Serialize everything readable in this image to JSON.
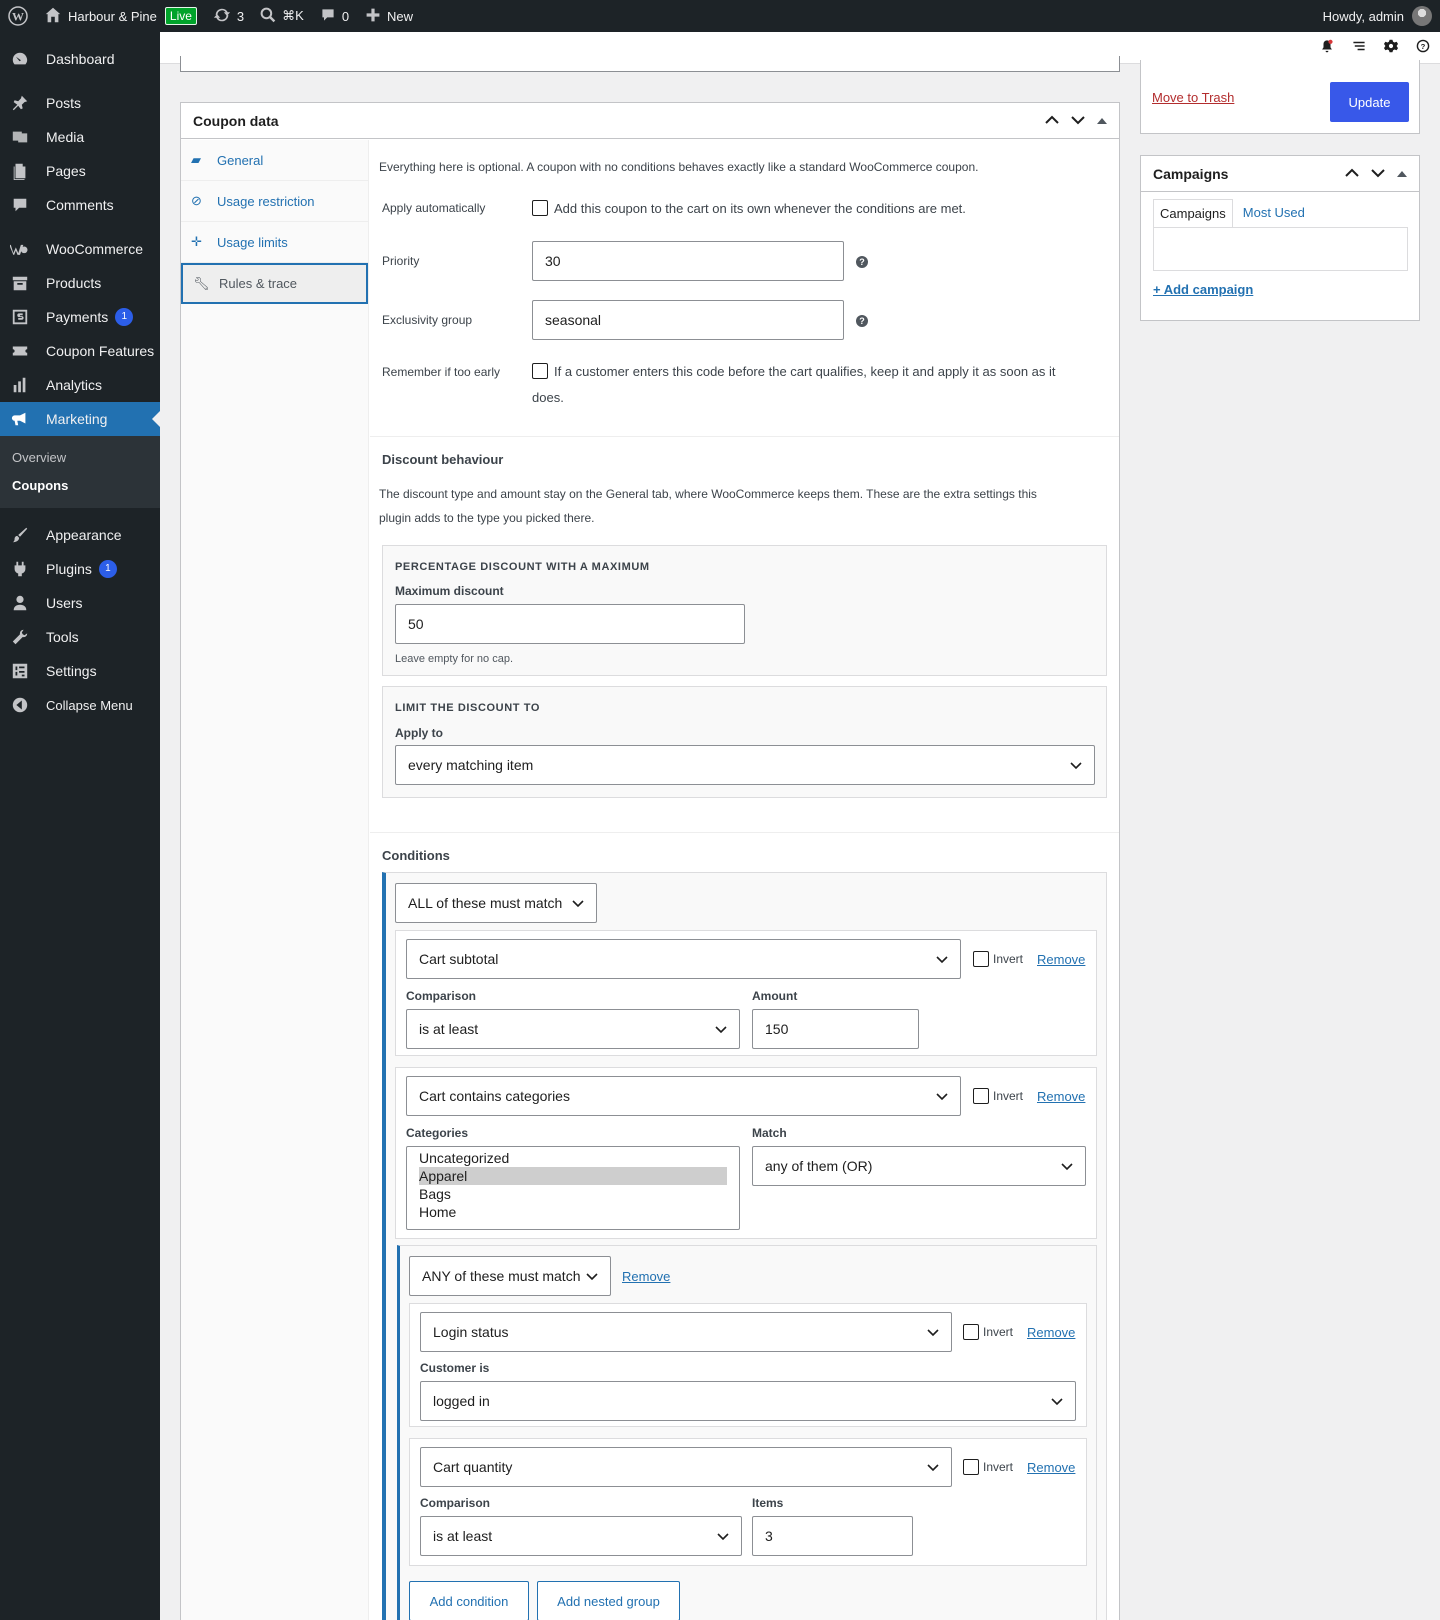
{
  "adminbar": {
    "site_name": "Harbour & Pine",
    "live_badge": "Live",
    "updates_count": "3",
    "command_shortcut": "⌘K",
    "comments_count": "0",
    "new_label": "New",
    "howdy": "Howdy, admin"
  },
  "sidebar": {
    "items": [
      {
        "label": "Dashboard",
        "icon": "dashboard-icon"
      },
      {
        "label": "Posts",
        "icon": "pin-icon"
      },
      {
        "label": "Media",
        "icon": "media-icon"
      },
      {
        "label": "Pages",
        "icon": "pages-icon"
      },
      {
        "label": "Comments",
        "icon": "comment-icon"
      },
      {
        "label": "WooCommerce",
        "icon": "woo-icon"
      },
      {
        "label": "Products",
        "icon": "archive-icon"
      },
      {
        "label": "Payments",
        "icon": "payments-icon",
        "badge": "1"
      },
      {
        "label": "Coupon Features",
        "icon": "features-icon"
      },
      {
        "label": "Analytics",
        "icon": "chart-icon"
      },
      {
        "label": "Marketing",
        "icon": "megaphone-icon"
      },
      {
        "label": "Appearance",
        "icon": "brush-icon"
      },
      {
        "label": "Plugins",
        "icon": "plug-icon",
        "badge": "1"
      },
      {
        "label": "Users",
        "icon": "user-icon"
      },
      {
        "label": "Tools",
        "icon": "wrench-icon"
      },
      {
        "label": "Settings",
        "icon": "settings-icon"
      },
      {
        "label": "Collapse Menu",
        "icon": "collapse-icon"
      }
    ],
    "submenu": [
      "Overview",
      "Coupons"
    ]
  },
  "coupon_data": {
    "title": "Coupon data",
    "tabs": [
      "General",
      "Usage restriction",
      "Usage limits",
      "Rules & trace"
    ],
    "intro": "Everything here is optional. A coupon with no conditions behaves exactly like a standard WooCommerce coupon.",
    "apply_auto_label": "Apply automatically",
    "apply_auto_text": "Add this coupon to the cart on its own whenever the conditions are met.",
    "priority_label": "Priority",
    "priority_value": "30",
    "exclusivity_label": "Exclusivity group",
    "exclusivity_value": "seasonal",
    "remember_label": "Remember if too early",
    "remember_text_1": "If a customer enters this code before the cart qualifies, keep it and apply it as soon as it",
    "remember_text_2": "does.",
    "discount_title": "Discount behaviour",
    "discount_para_1": "The discount type and amount stay on the General tab, where WooCommerce keeps them. These are the extra settings this",
    "discount_para_2": "plugin adds to the type you picked there.",
    "pct_caps": "PERCENTAGE DISCOUNT WITH A MAXIMUM",
    "max_label": "Maximum discount",
    "max_value": "50",
    "max_hint": "Leave empty for no cap.",
    "limit_caps": "LIMIT THE DISCOUNT TO",
    "apply_to_label": "Apply to",
    "apply_to_value": "every matching item",
    "conditions_title": "Conditions",
    "group_match": "ALL of these must match",
    "rule1": {
      "type": "Cart subtotal",
      "comparison_label": "Comparison",
      "comparison": "is at least",
      "amount_label": "Amount",
      "amount": "150"
    },
    "rule2": {
      "type": "Cart contains categories",
      "categories_label": "Categories",
      "categories": [
        "Uncategorized",
        "Apparel",
        "Bags",
        "Home"
      ],
      "selected": "Apparel",
      "match_label": "Match",
      "match": "any of them (OR)"
    },
    "nested_match": "ANY of these must match",
    "rule3": {
      "type": "Login status",
      "customer_label": "Customer is",
      "customer": "logged in"
    },
    "rule4": {
      "type": "Cart quantity",
      "comparison_label": "Comparison",
      "comparison": "is at least",
      "items_label": "Items",
      "items": "3"
    },
    "invert_label": "Invert",
    "remove_label": "Remove",
    "add_condition": "Add condition",
    "add_nested_group": "Add nested group"
  },
  "publish": {
    "trash_label": "Move to Trash",
    "update_label": "Update"
  },
  "campaigns": {
    "title": "Campaigns",
    "tab_all": "Campaigns",
    "tab_used": "Most Used",
    "add_label": "+ Add campaign"
  }
}
